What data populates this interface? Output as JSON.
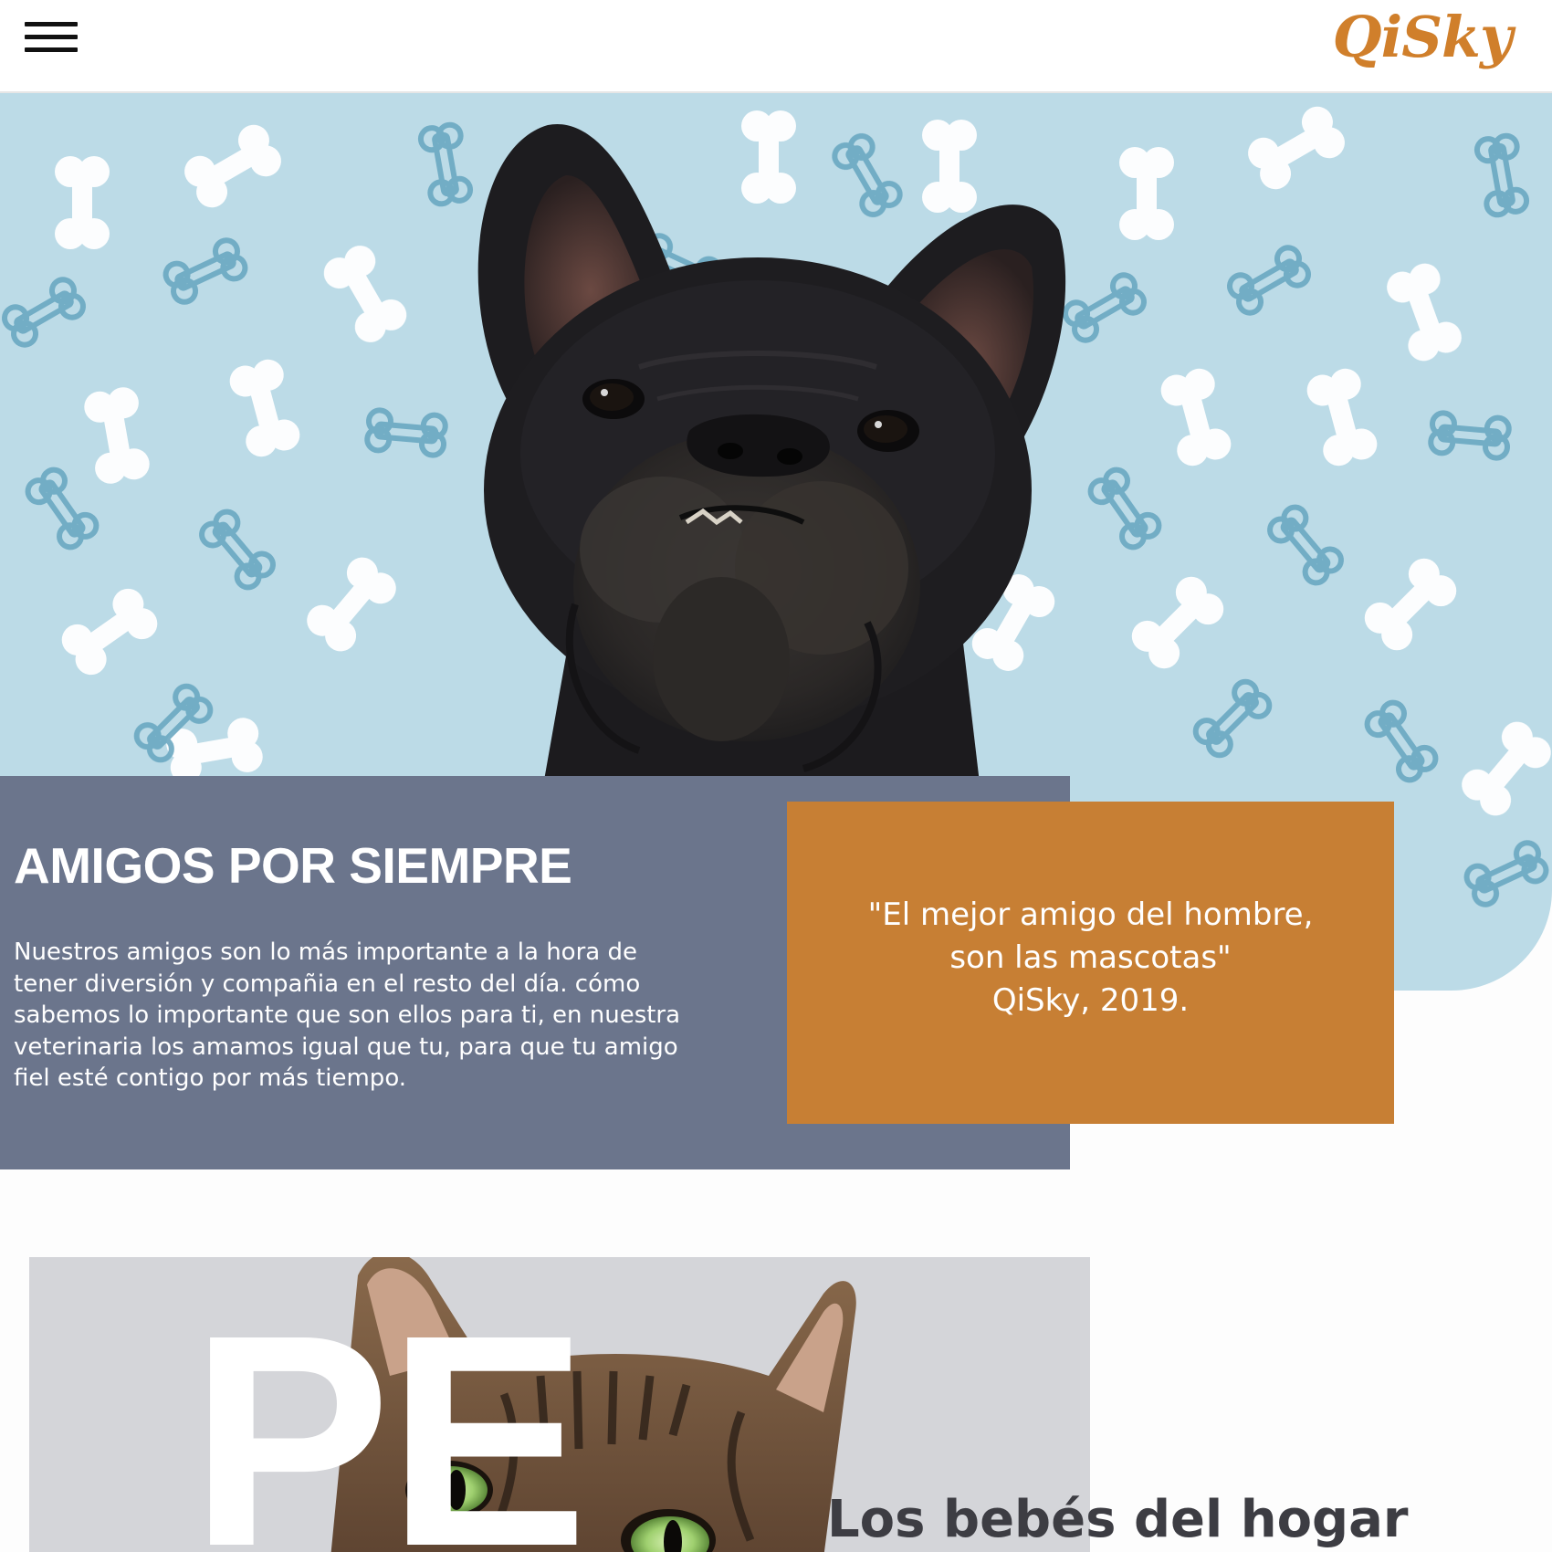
{
  "header": {
    "menu_icon": "hamburger-menu-icon",
    "logo_text": "QiSky"
  },
  "hero": {
    "image": "black-french-bulldog-on-blue-bone-pattern",
    "background_color": "#bcdbe7"
  },
  "intro": {
    "title": "AMIGOS POR SIEMPRE",
    "text": "Nuestros amigos son lo más importante a la hora de tener diversión y compañia en el resto del día. cómo sabemos lo importante que son ellos para ti, en nuestra veterinaria los amamos igual que tu, para que tu amigo fiel esté contigo por más tiempo.",
    "background_color": "#6b758c"
  },
  "quote": {
    "line1": "\"El mejor amigo del hombre,",
    "line2": "son las mascotas\"",
    "attribution": "QiSky, 2019.",
    "background_color": "#c77f34"
  },
  "pets": {
    "big_text": "PE",
    "subtitle": "Los bebés del hogar",
    "image": "tabby-cat-with-green-eyes"
  },
  "colors": {
    "brand_orange": "#d07f2b",
    "slate": "#6b758c",
    "sky_blue": "#bcdbe7"
  }
}
